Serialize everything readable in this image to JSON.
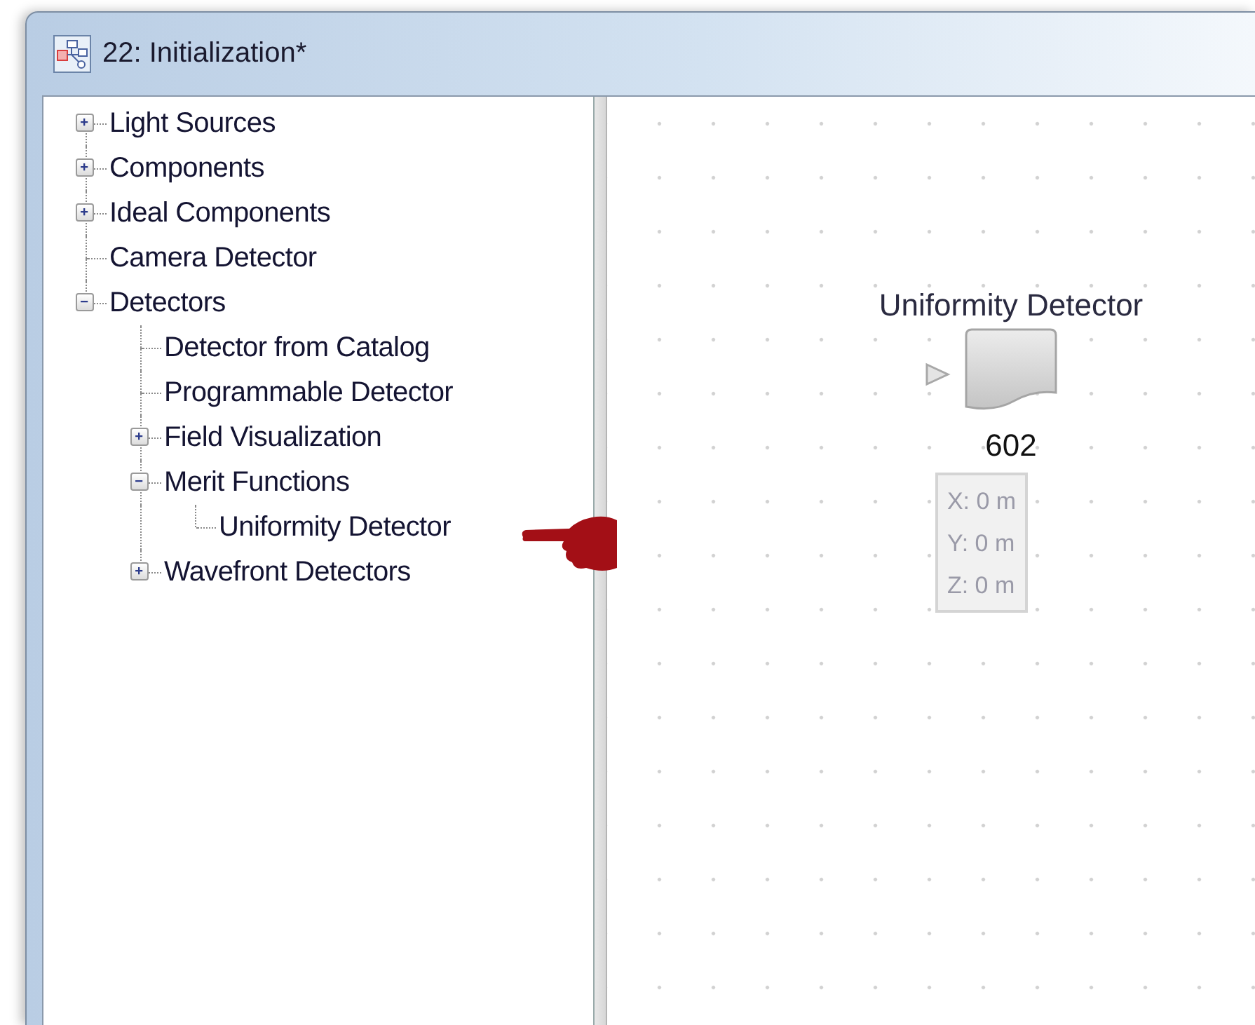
{
  "window": {
    "title": "22: Initialization*"
  },
  "tree": [
    {
      "label": "Light Sources",
      "expanded": false
    },
    {
      "label": "Components",
      "expanded": false
    },
    {
      "label": "Ideal Components",
      "expanded": false
    },
    {
      "label": "Camera Detector"
    },
    {
      "label": "Detectors",
      "expanded": true,
      "children": [
        {
          "label": "Detector from Catalog"
        },
        {
          "label": "Programmable Detector"
        },
        {
          "label": "Field Visualization",
          "expanded": false
        },
        {
          "label": "Merit Functions",
          "expanded": true,
          "children": [
            {
              "label": "Uniformity Detector"
            }
          ]
        },
        {
          "label": "Wavefront Detectors",
          "expanded": false
        }
      ]
    }
  ],
  "canvas": {
    "node": {
      "label": "Uniformity Detector",
      "number": "602",
      "coordinates": [
        "X: 0 m",
        "Y: 0 m",
        "Z: 0 m"
      ]
    }
  }
}
